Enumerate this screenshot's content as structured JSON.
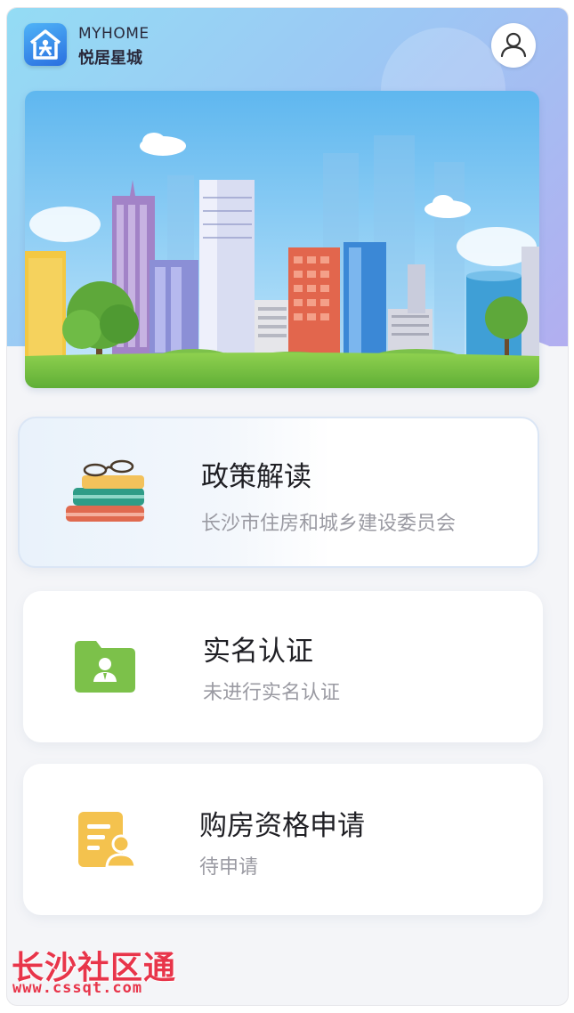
{
  "header": {
    "brand_en": "MYHOME",
    "brand_cn": "悦居星城",
    "logo_icon": "house-family-icon",
    "profile_icon": "user-icon"
  },
  "banner": {
    "illustration": "city-skyline-illustration"
  },
  "cards": [
    {
      "title": "政策解读",
      "subtitle": "长沙市住房和城乡建设委员会",
      "icon": "books-glasses-icon"
    },
    {
      "title": "实名认证",
      "subtitle": "未进行实名认证",
      "icon": "id-folder-icon",
      "icon_color": "#7cc14a"
    },
    {
      "title": "购房资格申请",
      "subtitle": "待申请",
      "icon": "application-document-icon",
      "icon_color": "#f4c24e"
    }
  ],
  "watermark": {
    "title": "长沙社区通",
    "url": "www.cssqt.com"
  },
  "colors": {
    "header_gradient_start": "#94dcf4",
    "header_gradient_end": "#b2aef0",
    "watermark": "#e8354a"
  }
}
